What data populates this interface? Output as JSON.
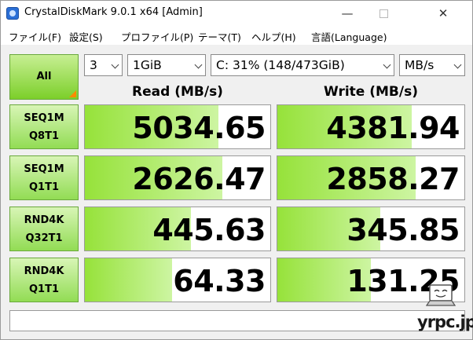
{
  "window": {
    "title": "CrystalDiskMark 9.0.1 x64 [Admin]",
    "buttons": {
      "minimize": "—",
      "close": "✕"
    }
  },
  "menu": [
    "ファイル(F)",
    "設定(S)",
    "プロファイル(P)",
    "テーマ(T)",
    "ヘルプ(H)",
    "言語(Language)"
  ],
  "controls": {
    "all_label": "All",
    "count": "3",
    "size": "1GiB",
    "drive": "C: 31% (148/473GiB)",
    "unit": "MB/s"
  },
  "headers": {
    "read": "Read (MB/s)",
    "write": "Write (MB/s)"
  },
  "rows": [
    {
      "label1": "SEQ1M",
      "label2": "Q8T1",
      "read": "5034.65",
      "write": "4381.94",
      "read_fill": 0.72,
      "write_fill": 0.72
    },
    {
      "label1": "SEQ1M",
      "label2": "Q1T1",
      "read": "2626.47",
      "write": "2858.27",
      "read_fill": 0.74,
      "write_fill": 0.74
    },
    {
      "label1": "RND4K",
      "label2": "Q32T1",
      "read": "445.63",
      "write": "345.85",
      "read_fill": 0.57,
      "write_fill": 0.55
    },
    {
      "label1": "RND4K",
      "label2": "Q1T1",
      "read": "64.33",
      "write": "131.25",
      "read_fill": 0.47,
      "write_fill": 0.5
    }
  ],
  "status_text": "",
  "watermark": "yrpc.jp",
  "colors": {
    "bar": "#96e23a",
    "label": "#92dc54",
    "corner": "#ff8a00"
  }
}
